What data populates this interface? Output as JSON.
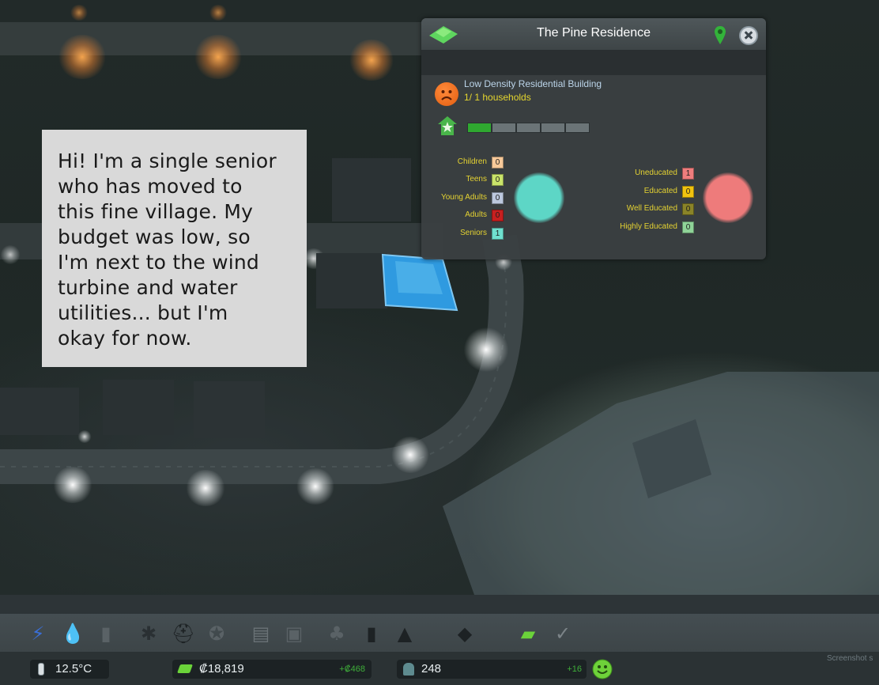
{
  "speech_bubble": {
    "lines": [
      "Hi! I'm a single senior",
      "who has moved to",
      "this fine village. My",
      "budget was low, so",
      "I'm next to the wind",
      "turbine and water",
      "utilities... but I'm",
      "okay for now."
    ]
  },
  "info_panel": {
    "title": "The Pine Residence",
    "building_type": "Low Density Residential Building",
    "households": "1/ 1 households",
    "level": {
      "current": 1,
      "max": 5
    },
    "age_groups": [
      {
        "label": "Children",
        "value": "0",
        "color": "#f7c99a"
      },
      {
        "label": "Teens",
        "value": "0",
        "color": "#c9e36a"
      },
      {
        "label": "Young Adults",
        "value": "0",
        "color": "#bcc8de"
      },
      {
        "label": "Adults",
        "value": "0",
        "color": "#c62020"
      },
      {
        "label": "Seniors",
        "value": "1",
        "color": "#6fe0cf"
      }
    ],
    "education_groups": [
      {
        "label": "Uneducated",
        "value": "1",
        "color": "#ef7d7d"
      },
      {
        "label": "Educated",
        "value": "0",
        "color": "#f1c30f"
      },
      {
        "label": "Well Educated",
        "value": "0",
        "color": "#8a8428"
      },
      {
        "label": "Highly Educated",
        "value": "0",
        "color": "#8fd398"
      }
    ],
    "age_pie_color": "#5dd6c6",
    "education_pie_color": "#ee7b7b"
  },
  "toolbar_icons": [
    {
      "name": "electricity-icon",
      "glyph": "⚡",
      "color": "#3a6fd8"
    },
    {
      "name": "water-drop-icon",
      "glyph": "💧",
      "color": "#2f9ce0"
    },
    {
      "name": "garbage-icon",
      "glyph": "▮",
      "color": "#5a6266"
    },
    {
      "name": "healthcare-icon",
      "glyph": "✱",
      "color": "#2a3033"
    },
    {
      "name": "fire-department-icon",
      "glyph": "⛑",
      "color": "#1d2224"
    },
    {
      "name": "police-icon",
      "glyph": "✪",
      "color": "#5a6266"
    },
    {
      "name": "education-icon",
      "glyph": "▤",
      "color": "#6a7276"
    },
    {
      "name": "public-transport-icon",
      "glyph": "▣",
      "color": "#5a6266"
    },
    {
      "name": "parks-icon",
      "glyph": "♣",
      "color": "#5a6266"
    },
    {
      "name": "monument-icon",
      "glyph": "▮",
      "color": "#1d2224"
    },
    {
      "name": "landmark-icon",
      "glyph": "▲",
      "color": "#1d2224"
    },
    {
      "name": "area-icon",
      "glyph": "◆",
      "color": "#1d2224"
    },
    {
      "name": "money-icon",
      "glyph": "▰",
      "color": "#6bd33a"
    },
    {
      "name": "checkbox-icon",
      "glyph": "✓",
      "color": "#7c8488"
    }
  ],
  "status_bar": {
    "temperature": "12.5°C",
    "money": "₡18,819",
    "money_delta": "+₡468",
    "population": "248",
    "population_delta": "+16",
    "screenshot_label": "Screenshot s"
  }
}
